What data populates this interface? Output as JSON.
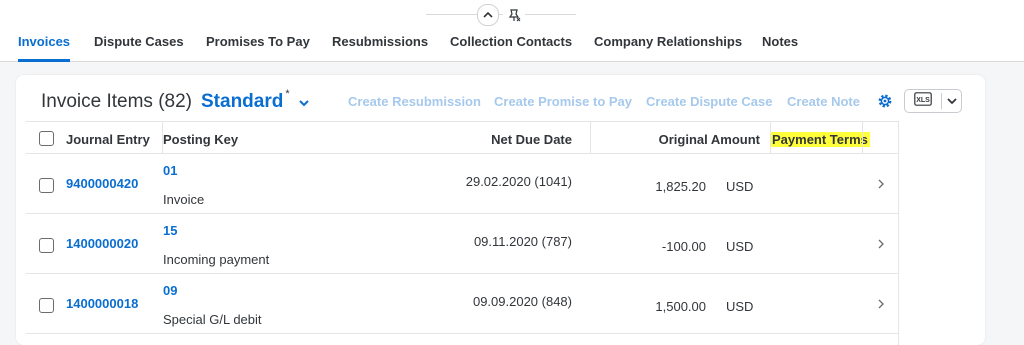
{
  "header": {
    "collapse_icon": "chevron-up-icon",
    "pin_icon": "unpin-icon"
  },
  "tabs": [
    {
      "label": "Invoices",
      "active": true
    },
    {
      "label": "Dispute Cases"
    },
    {
      "label": "Promises To Pay"
    },
    {
      "label": "Resubmissions"
    },
    {
      "label": "Collection Contacts"
    },
    {
      "label": "Company Relationships"
    },
    {
      "label": "Notes"
    }
  ],
  "table": {
    "title": "Invoice Items (82)",
    "variant": "Standard",
    "variant_modified_marker": "*",
    "actions": {
      "create_resubmission": "Create Resubmission",
      "create_promise": "Create Promise to Pay",
      "create_dispute": "Create Dispute Case",
      "create_note": "Create Note"
    },
    "settings_icon": "gear-icon",
    "export_label": "XLS",
    "columns": {
      "journal_entry": "Journal Entry",
      "posting_key": "Posting Key",
      "net_due_date": "Net Due Date",
      "original_amount": "Original Amount",
      "payment_terms": "Payment Terms"
    },
    "rows": [
      {
        "journal_entry": "9400000420",
        "posting_key": "01",
        "posting_key_text": "Invoice",
        "net_due_date": "29.02.2020 (1041)",
        "amount": "1,825.20",
        "currency": "USD"
      },
      {
        "journal_entry": "1400000020",
        "posting_key": "15",
        "posting_key_text": "Incoming payment",
        "net_due_date": "09.11.2020 (787)",
        "amount": "-100.00",
        "currency": "USD"
      },
      {
        "journal_entry": "1400000018",
        "posting_key": "09",
        "posting_key_text": "Special G/L debit",
        "net_due_date": "09.09.2020 (848)",
        "amount": "1,500.00",
        "currency": "USD"
      }
    ]
  },
  "colors": {
    "accent": "#0a6ed1",
    "disabled_action": "#a6c9ec",
    "highlight": "#ffff3a"
  }
}
